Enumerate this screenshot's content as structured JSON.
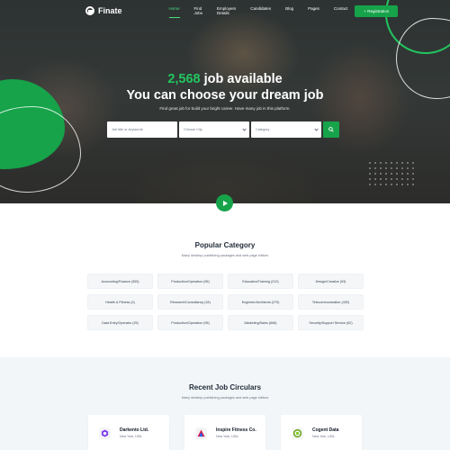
{
  "brand": {
    "name": "Finate"
  },
  "nav": {
    "items": [
      {
        "label": "Home",
        "active": true
      },
      {
        "label": "Find Jobs"
      },
      {
        "label": "Employers Details"
      },
      {
        "label": "Candidates"
      },
      {
        "label": "Blog"
      },
      {
        "label": "Pages"
      },
      {
        "label": "Contact"
      }
    ],
    "register_label": "+ Registration"
  },
  "hero": {
    "count": "2,568",
    "title_rest": "job available",
    "title_line2": "You can choose your dream job",
    "subtitle": "Find great job for build your bright career. Have many job in this platform.",
    "search": {
      "keyword_placeholder": "Job title or keywords",
      "city_placeholder": "Choose City",
      "category_placeholder": "Category"
    }
  },
  "popular": {
    "title": "Popular Category",
    "subtitle": "Many desktop publishing packages and web page editors",
    "categories": [
      "Accounting/Finance (305)",
      "Production/Operation (95)",
      "Education/Training (212)",
      "Design/Creative (93)",
      "Health & Fitness (4)",
      "Research/Consultancy (34)",
      "Engineer/Architects (270)",
      "Telecommunication (430)",
      "Data Entry/Operator (25)",
      "Production/Operation (95)",
      "Marketing/Sales (666)",
      "Security/Support Service (62)"
    ]
  },
  "recent": {
    "title": "Recent Job Circulars",
    "subtitle": "Many desktop publishing packages and web page editors",
    "jobs": [
      {
        "company": "Darkento Ltd.",
        "location": "New York, USA",
        "icon": "hexagon-logo-icon",
        "color": "#7c3aed"
      },
      {
        "company": "Inspire Fitness Co.",
        "location": "New York, USA",
        "icon": "triangle-logo-icon",
        "color": "#e11d48"
      },
      {
        "company": "Cogent Data",
        "location": "New York, USA",
        "icon": "circle-logo-icon",
        "color": "#65a30d"
      }
    ]
  },
  "colors": {
    "accent": "#16a34a",
    "accent_light": "#22c55e"
  }
}
